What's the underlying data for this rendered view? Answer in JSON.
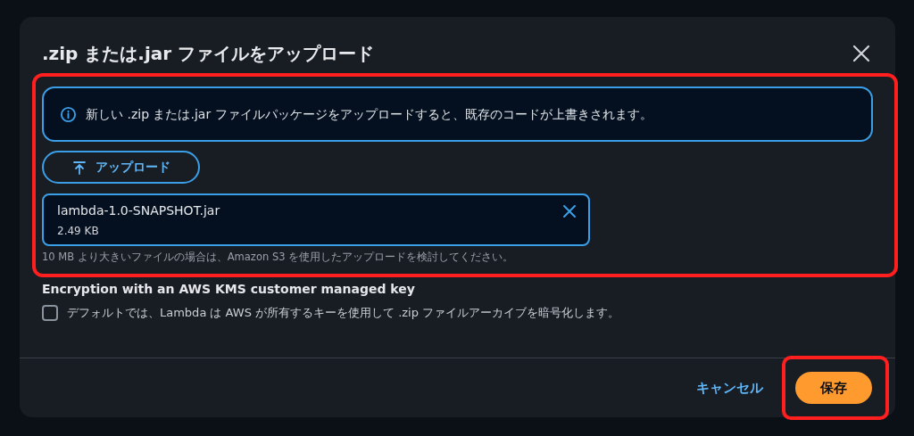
{
  "dialog": {
    "title": ".zip または.jar ファイルをアップロード",
    "info": "新しい .zip または.jar ファイルパッケージをアップロードすると、既存のコードが上書きされます。",
    "upload_button": "アップロード",
    "file": {
      "name": "lambda-1.0-SNAPSHOT.jar",
      "size": "2.49 KB"
    },
    "hint": "10 MB より大きいファイルの場合は、Amazon S3 を使用したアップロードを検討してください。",
    "encryption": {
      "label": "Encryption with an AWS KMS customer managed key",
      "checked": false,
      "description": "デフォルトでは、Lambda は AWS が所有するキーを使用して .zip ファイルアーカイブを暗号化します。"
    },
    "buttons": {
      "cancel": "キャンセル",
      "save": "保存"
    }
  }
}
